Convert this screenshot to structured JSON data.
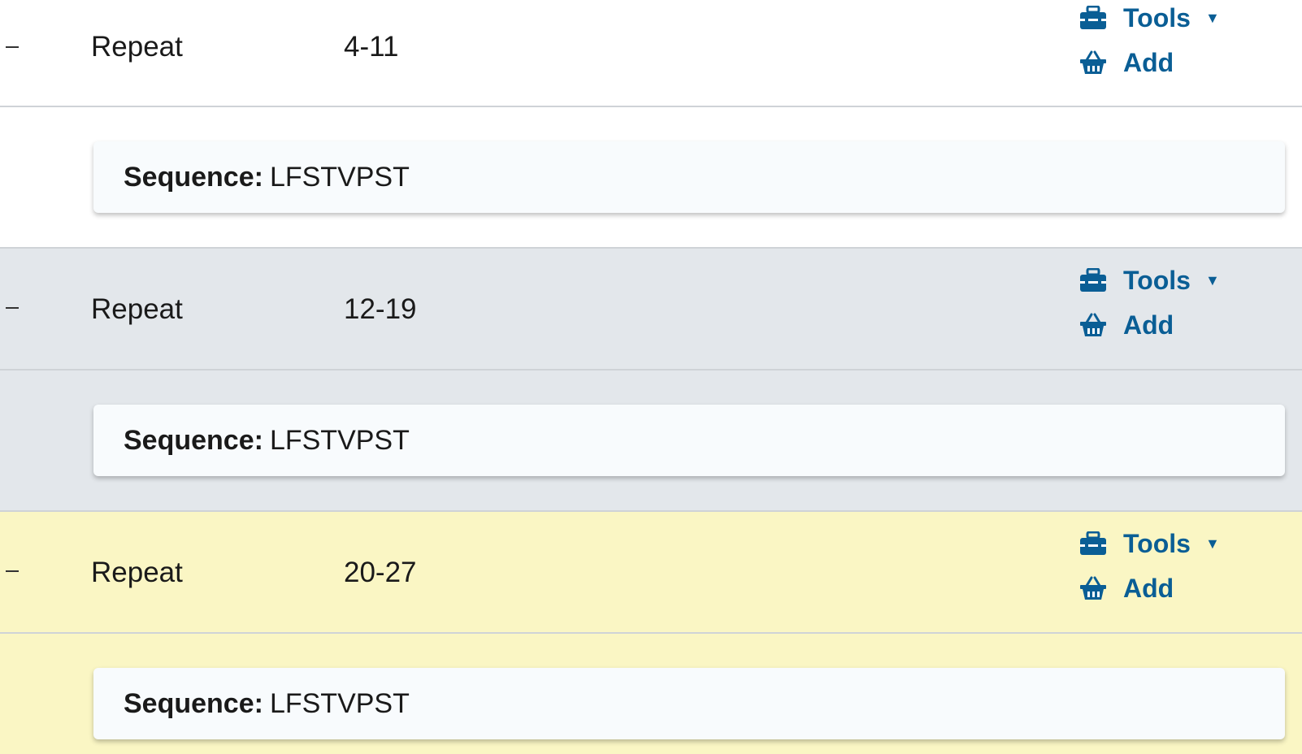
{
  "repeats": [
    {
      "type": "Repeat",
      "range": "4-11",
      "tools_label": "Tools",
      "add_label": "Add",
      "sequence_label": "Sequence:",
      "sequence_value": "LFSTVPST",
      "background": "#ffffff"
    },
    {
      "type": "Repeat",
      "range": "12-19",
      "tools_label": "Tools",
      "add_label": "Add",
      "sequence_label": "Sequence:",
      "sequence_value": "LFSTVPST",
      "background": "#e3e7eb"
    },
    {
      "type": "Repeat",
      "range": "20-27",
      "tools_label": "Tools",
      "add_label": "Add",
      "sequence_label": "Sequence:",
      "sequence_value": "LFSTVPST",
      "background": "#faf6c4"
    }
  ],
  "icons": {
    "toggle": "minus-icon",
    "tools": "toolbox-icon",
    "dropdown": "caret-down-icon",
    "add": "basket-icon"
  },
  "colors": {
    "link": "#0a5e95",
    "divider": "#cfd3d7"
  }
}
